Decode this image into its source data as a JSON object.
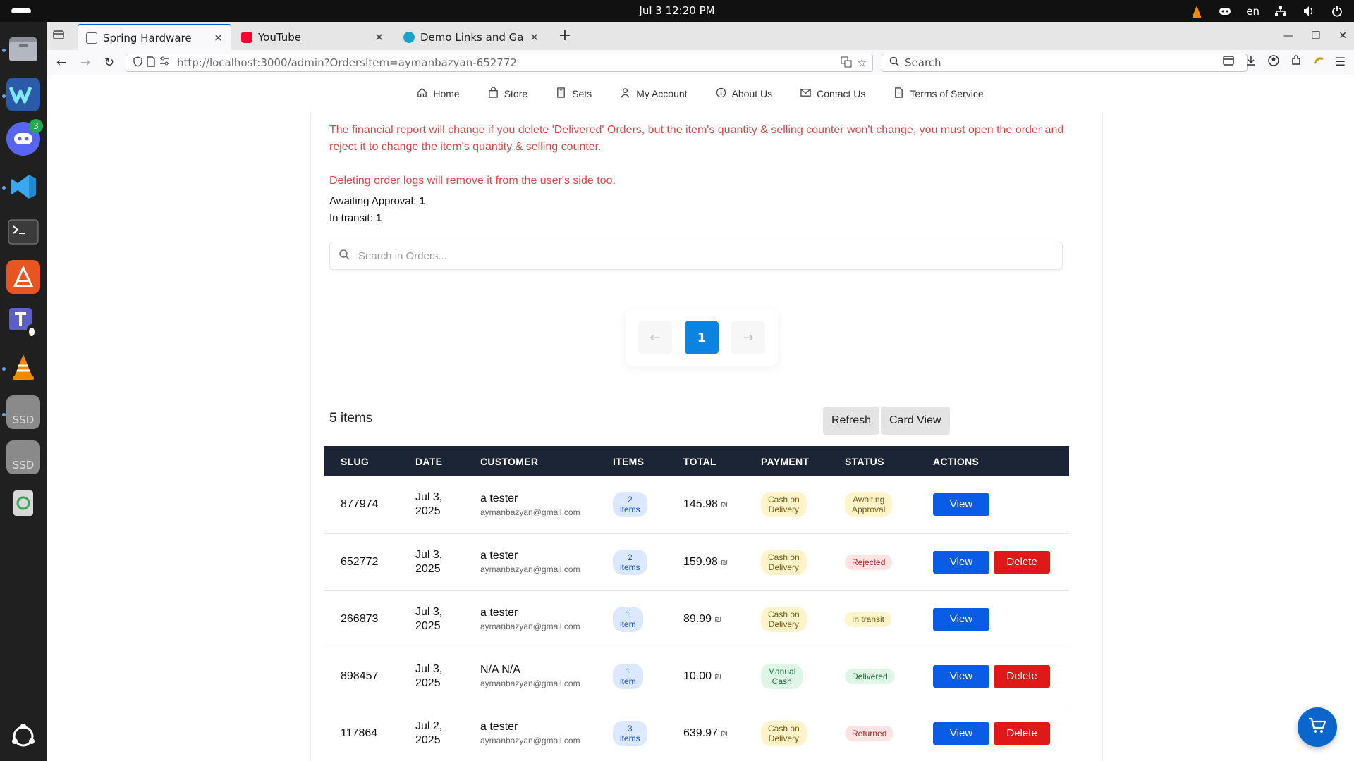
{
  "system": {
    "clock": "Jul 3  12:20 PM",
    "lang": "en"
  },
  "dock": {
    "discord_badge": "3",
    "ssd_label": "SSD"
  },
  "browser": {
    "tabs": [
      {
        "title": "Spring Hardware",
        "color": "#666666"
      },
      {
        "title": "YouTube",
        "color": "#ff0033"
      },
      {
        "title": "Demo Links and Gallery |",
        "color": "#1aa3c8"
      }
    ],
    "url_host": "http://localhost",
    "url_rest": ":3000/admin?OrdersItem=aymanbazyan-652772",
    "search_placeholder": "Search"
  },
  "site_nav": [
    {
      "label": "Home",
      "icon": "home-icon"
    },
    {
      "label": "Store",
      "icon": "bag-icon"
    },
    {
      "label": "Sets",
      "icon": "building-icon"
    },
    {
      "label": "My Account",
      "icon": "user-icon"
    },
    {
      "label": "About Us",
      "icon": "info-icon"
    },
    {
      "label": "Contact Us",
      "icon": "mail-icon"
    },
    {
      "label": "Terms of Service",
      "icon": "document-icon"
    }
  ],
  "notices": {
    "financial": "The financial report will change if you delete 'Delivered' Orders, but the item's quantity & selling counter won't change, you must open the order and reject it to change the item's quantity & selling counter.",
    "deleting": "Deleting order logs will remove it from the user's side too."
  },
  "counts": {
    "awaiting_label": "Awaiting Approval:",
    "awaiting_value": "1",
    "transit_label": "In transit:",
    "transit_value": "1"
  },
  "order_search": {
    "placeholder": "Search in Orders..."
  },
  "pager": {
    "prev": "←",
    "current": "1",
    "next": "→"
  },
  "toolbar": {
    "items_count": "5 items",
    "refresh": "Refresh",
    "card_view": "Card View"
  },
  "table": {
    "headers": [
      "SLUG",
      "DATE",
      "CUSTOMER",
      "ITEMS",
      "TOTAL",
      "PAYMENT",
      "STATUS",
      "ACTIONS"
    ],
    "view_label": "View",
    "delete_label": "Delete",
    "currency": "₪",
    "rows": [
      {
        "slug": "877974",
        "date_1": "Jul 3,",
        "date_2": "2025",
        "name": "a tester",
        "email": "aymanbazyan@gmail.com",
        "items_1": "2",
        "items_2": "items",
        "total": "145.98",
        "pay_1": "Cash on",
        "pay_2": "Delivery",
        "status_1": "Awaiting",
        "status_2": "Approval",
        "status_kind": "await",
        "deletable": false
      },
      {
        "slug": "652772",
        "date_1": "Jul 3,",
        "date_2": "2025",
        "name": "a tester",
        "email": "aymanbazyan@gmail.com",
        "items_1": "2",
        "items_2": "items",
        "total": "159.98",
        "pay_1": "Cash on",
        "pay_2": "Delivery",
        "status_1": "Rejected",
        "status_2": "",
        "status_kind": "rej",
        "deletable": true
      },
      {
        "slug": "266873",
        "date_1": "Jul 3,",
        "date_2": "2025",
        "name": "a tester",
        "email": "aymanbazyan@gmail.com",
        "items_1": "1",
        "items_2": "item",
        "total": "89.99",
        "pay_1": "Cash on",
        "pay_2": "Delivery",
        "status_1": "In transit",
        "status_2": "",
        "status_kind": "trans",
        "deletable": false
      },
      {
        "slug": "898457",
        "date_1": "Jul 3,",
        "date_2": "2025",
        "name": "N/A N/A",
        "email": "aymanbazyan@gmail.com",
        "items_1": "1",
        "items_2": "item",
        "total": "10.00",
        "pay_1": "Manual",
        "pay_2": "Cash",
        "status_1": "Delivered",
        "status_2": "",
        "status_kind": "del",
        "deletable": true
      },
      {
        "slug": "117864",
        "date_1": "Jul 2,",
        "date_2": "2025",
        "name": "a tester",
        "email": "aymanbazyan@gmail.com",
        "items_1": "3",
        "items_2": "items",
        "total": "639.97",
        "pay_1": "Cash on",
        "pay_2": "Delivery",
        "status_1": "Returned",
        "status_2": "",
        "status_kind": "ret",
        "deletable": true
      }
    ]
  }
}
